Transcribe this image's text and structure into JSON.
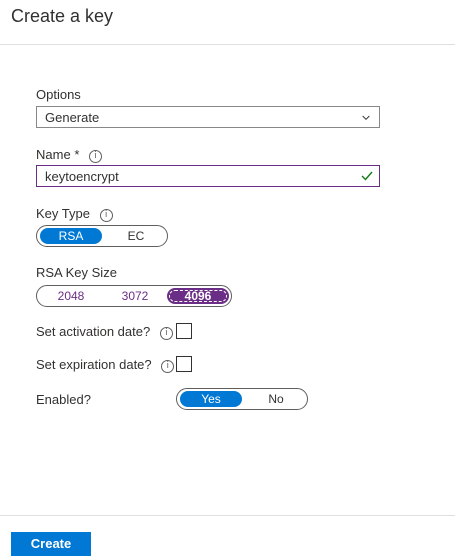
{
  "header": {
    "title": "Create a key"
  },
  "options": {
    "label": "Options",
    "value": "Generate"
  },
  "name": {
    "label": "Name",
    "required_mark": "*",
    "value": "keytoencrypt"
  },
  "key_type": {
    "label": "Key Type",
    "options": [
      "RSA",
      "EC"
    ],
    "selected": "RSA"
  },
  "rsa_key_size": {
    "label": "RSA Key Size",
    "options": [
      "2048",
      "3072",
      "4096"
    ],
    "selected": "4096"
  },
  "activation": {
    "label": "Set activation date?",
    "checked": false
  },
  "expiration": {
    "label": "Set expiration date?",
    "checked": false
  },
  "enabled": {
    "label": "Enabled?",
    "options": [
      "Yes",
      "No"
    ],
    "selected": "Yes"
  },
  "footer": {
    "create_label": "Create"
  },
  "colors": {
    "accent": "#0078d4",
    "selected_size": "#6b2e86"
  },
  "icons": {
    "info": "i"
  }
}
